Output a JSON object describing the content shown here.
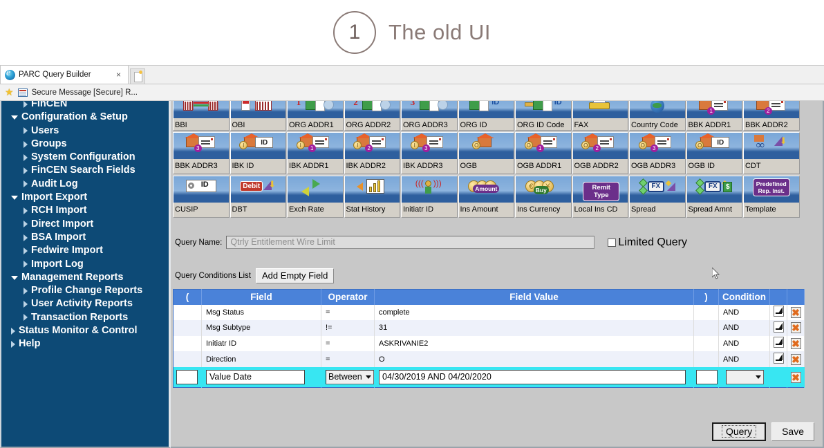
{
  "slide": {
    "number": "1",
    "title": "The old UI"
  },
  "browser": {
    "tab_title": "PARC Query Builder",
    "tab_close_label": "×",
    "new_tab_name": "new-tab-button",
    "bookmark_label": "Secure Message [Secure] R..."
  },
  "sidebar": {
    "items": [
      {
        "label": "FinCEN",
        "level": 1,
        "caret": "right"
      },
      {
        "label": "Configuration & Setup",
        "level": 0,
        "caret": "down"
      },
      {
        "label": "Users",
        "level": 1,
        "caret": "right"
      },
      {
        "label": "Groups",
        "level": 1,
        "caret": "right"
      },
      {
        "label": "System Configuration",
        "level": 1,
        "caret": "right"
      },
      {
        "label": "FinCEN Search Fields",
        "level": 1,
        "caret": "right"
      },
      {
        "label": "Audit Log",
        "level": 1,
        "caret": "right"
      },
      {
        "label": "Import Export",
        "level": 0,
        "caret": "down"
      },
      {
        "label": "RCH Import",
        "level": 1,
        "caret": "right"
      },
      {
        "label": "Direct Import",
        "level": 1,
        "caret": "right"
      },
      {
        "label": "BSA Import",
        "level": 1,
        "caret": "right"
      },
      {
        "label": "Fedwire Import",
        "level": 1,
        "caret": "right"
      },
      {
        "label": "Import Log",
        "level": 1,
        "caret": "right"
      },
      {
        "label": "Management Reports",
        "level": 0,
        "caret": "down"
      },
      {
        "label": "Profile Change Reports",
        "level": 1,
        "caret": "right"
      },
      {
        "label": "User Activity Reports",
        "level": 1,
        "caret": "right"
      },
      {
        "label": "Transaction Reports",
        "level": 1,
        "caret": "right"
      },
      {
        "label": "Status Monitor & Control",
        "level": 0,
        "caret": "right"
      },
      {
        "label": "Help",
        "level": 0,
        "caret": "right"
      }
    ]
  },
  "icon_palette": {
    "rows": [
      [
        {
          "label": "BBI",
          "icon": "bank-columns-icon"
        },
        {
          "label": "OBI",
          "icon": "bank-note-icon"
        },
        {
          "label": "ORG ADDR1",
          "icon": "org-address-1-icon"
        },
        {
          "label": "ORG ADDR2",
          "icon": "org-address-2-icon"
        },
        {
          "label": "ORG ADDR3",
          "icon": "org-address-3-icon"
        },
        {
          "label": "ORG ID",
          "icon": "org-id-icon"
        },
        {
          "label": "ORG ID Code",
          "icon": "org-id-code-icon"
        },
        {
          "label": "FAX",
          "icon": "fax-icon"
        },
        {
          "label": "Country Code",
          "icon": "globe-icon"
        },
        {
          "label": "BBK ADDR1",
          "icon": "bbk-address-1-icon"
        },
        {
          "label": "BBK ADDR2",
          "icon": "bbk-address-2-icon"
        }
      ],
      [
        {
          "label": "BBK ADDR3",
          "icon": "bbk-address-3-icon"
        },
        {
          "label": "IBK ID",
          "icon": "ibk-id-icon"
        },
        {
          "label": "IBK ADDR1",
          "icon": "ibk-address-1-icon"
        },
        {
          "label": "IBK ADDR2",
          "icon": "ibk-address-2-icon"
        },
        {
          "label": "IBK ADDR3",
          "icon": "ibk-address-3-icon"
        },
        {
          "label": "OGB",
          "icon": "ogb-icon"
        },
        {
          "label": "OGB ADDR1",
          "icon": "ogb-address-1-icon"
        },
        {
          "label": "OGB ADDR2",
          "icon": "ogb-address-2-icon"
        },
        {
          "label": "OGB ADDR3",
          "icon": "ogb-address-3-icon"
        },
        {
          "label": "OGB ID",
          "icon": "ogb-id-icon"
        },
        {
          "label": "CDT",
          "icon": "credit-icon"
        }
      ],
      [
        {
          "label": "CUSIP",
          "icon": "cusip-key-id-icon"
        },
        {
          "label": "DBT",
          "icon": "debit-icon"
        },
        {
          "label": "Exch Rate",
          "icon": "exchange-rate-icon"
        },
        {
          "label": "Stat History",
          "icon": "stat-history-icon"
        },
        {
          "label": "Initiatr ID",
          "icon": "initiator-id-icon"
        },
        {
          "label": "Ins Amount",
          "icon": "ins-amount-icon"
        },
        {
          "label": "Ins Currency",
          "icon": "ins-currency-icon"
        },
        {
          "label": "Local Ins CD",
          "icon": "remit-type-icon"
        },
        {
          "label": "Spread",
          "icon": "spread-fx-icon"
        },
        {
          "label": "Spread Amnt",
          "icon": "spread-amount-icon"
        },
        {
          "label": "Template",
          "icon": "predefined-rep-inst-icon"
        }
      ]
    ],
    "badge_texts": {
      "id": "ID",
      "debit": "Debit",
      "amount": "Amount",
      "buy": "Buy",
      "remit_type": "Remit Type",
      "fx": "FX",
      "dollar": "$",
      "template_line1": "Predefined",
      "template_line2": "Rep. Inst."
    }
  },
  "form": {
    "query_name_label": "Query Name:",
    "query_name_placeholder": "Qtrly Entitlement Wire Limit",
    "query_name_value": "",
    "limited_query_label": "Limited Query",
    "limited_query_checked": false,
    "conditions_list_label": "Query Conditions List",
    "add_empty_field_label": "Add Empty Field"
  },
  "conditions_table": {
    "headers": [
      "(",
      "Field",
      "Operator",
      "Field Value",
      ")",
      "Condition",
      "",
      ""
    ],
    "rows": [
      {
        "open": "",
        "field": "Msg Status",
        "operator": "=",
        "value": "complete",
        "close": "",
        "condition": "AND"
      },
      {
        "open": "",
        "field": "Msg Subtype",
        "operator": "!=",
        "value": "31",
        "close": "",
        "condition": "AND"
      },
      {
        "open": "",
        "field": "Initiatr ID",
        "operator": "=",
        "value": "ASKRIVANIE2",
        "close": "",
        "condition": "AND"
      },
      {
        "open": "",
        "field": "Direction",
        "operator": "=",
        "value": "O",
        "close": "",
        "condition": "AND"
      }
    ],
    "active_row": {
      "open": "",
      "field": "Value Date",
      "operator": "Between",
      "value": "04/30/2019 AND 04/20/2020",
      "close": "",
      "condition": ""
    }
  },
  "footer": {
    "query_button_label": "Query",
    "save_button_label": "Save"
  },
  "colors": {
    "sidebar_bg": "#0d4a76",
    "table_header_bg": "#4a82d9",
    "active_row_bg": "#38e6f2",
    "app_bg": "#c8c8c8",
    "title_text": "#8a7a76"
  }
}
